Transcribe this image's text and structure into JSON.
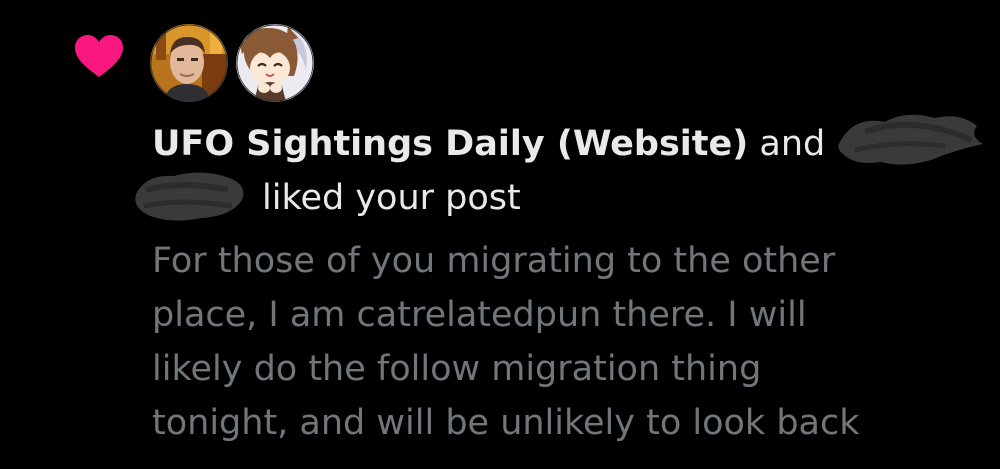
{
  "colors": {
    "background": "#000000",
    "heart": "#f91880",
    "primary_text": "#e7e9ea",
    "secondary_text": "#71767b",
    "redaction": "#3a3a3a"
  },
  "icons": {
    "like": "heart-icon"
  },
  "notification": {
    "actor_name": "UFO Sightings Daily (Website)",
    "conjunction": " and",
    "action_text": "liked your post",
    "post_lines": [
      "For those of you migrating to the other",
      "place, I am catrelatedpun there. I will",
      "likely do the follow migration thing",
      "tonight, and will be unlikely to look back"
    ]
  }
}
